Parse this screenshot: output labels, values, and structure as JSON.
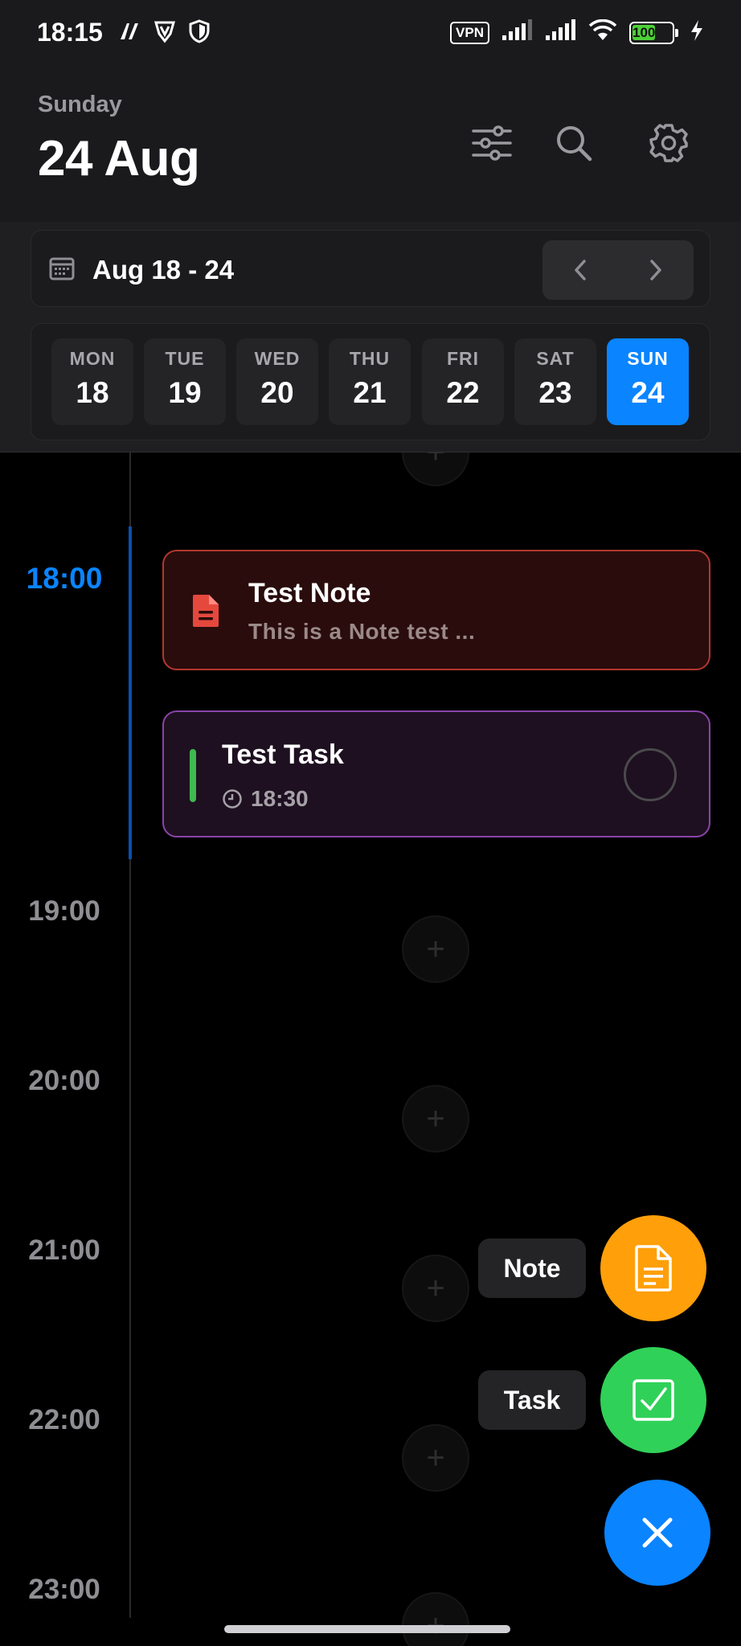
{
  "status_bar": {
    "time": "18:15",
    "vpn_label": "VPN",
    "battery_level": "100"
  },
  "header": {
    "weekday": "Sunday",
    "date": "24 Aug"
  },
  "week": {
    "range": "Aug 18 - 24",
    "days": [
      {
        "name": "MON",
        "num": "18"
      },
      {
        "name": "TUE",
        "num": "19"
      },
      {
        "name": "WED",
        "num": "20"
      },
      {
        "name": "THU",
        "num": "21"
      },
      {
        "name": "FRI",
        "num": "22"
      },
      {
        "name": "SAT",
        "num": "23"
      },
      {
        "name": "SUN",
        "num": "24"
      }
    ],
    "selected_index": 6
  },
  "timeline": {
    "hours": [
      "18:00",
      "19:00",
      "20:00",
      "21:00",
      "22:00",
      "23:00"
    ],
    "current_hour": "18:00",
    "add_symbol": "+"
  },
  "note_card": {
    "title": "Test Note",
    "preview": "This is a Note test ..."
  },
  "task_card": {
    "title": "Test Task",
    "time": "18:30"
  },
  "fab_menu": {
    "note_label": "Note",
    "task_label": "Task"
  },
  "colors": {
    "accent_blue": "#0a84ff",
    "note_orange": "#ff9f0a",
    "task_green": "#30d158",
    "note_red": "#e5483d"
  }
}
